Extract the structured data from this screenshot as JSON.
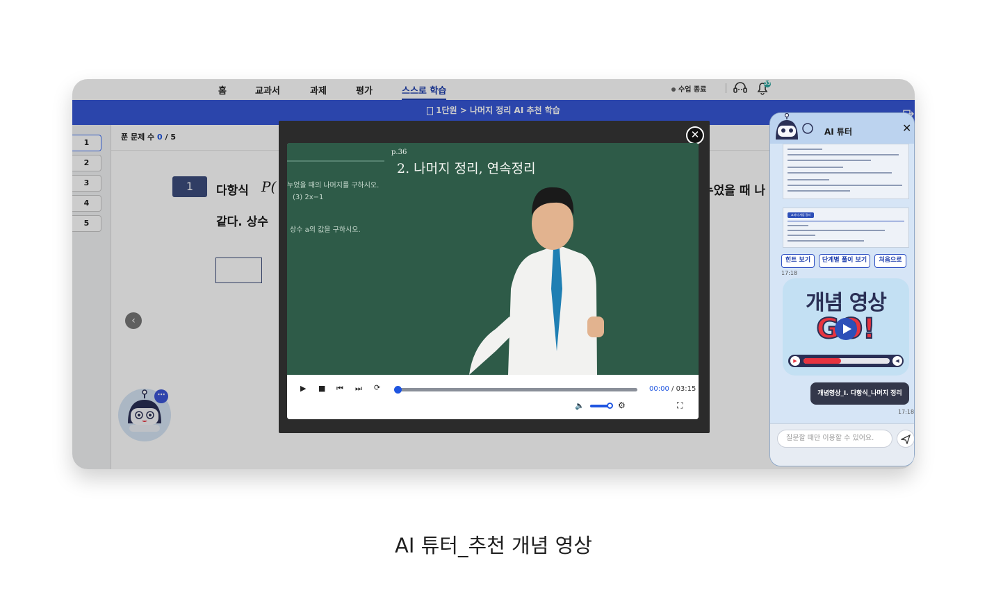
{
  "nav": {
    "items": [
      "홈",
      "교과서",
      "과제",
      "평가",
      "스스로 학습"
    ],
    "active_index": 4,
    "end_class_label": "수업 종료",
    "notification_count": "33"
  },
  "breadcrumb": "1단원 > 나머지 정리 AI 추천 학습",
  "question_nav": [
    "1",
    "2",
    "3",
    "4",
    "5"
  ],
  "solved": {
    "label": "푼 문제 수",
    "count": "0",
    "total": "/ 5"
  },
  "question": {
    "number": "1",
    "line1_start": "다항식",
    "line1_var": "P(",
    "line1_end": "누었을 때 나",
    "line2_start": "같다. 상수"
  },
  "video": {
    "board_heading": "2. 나머지 정리, 연속정리",
    "board_page": "p.36",
    "board_line1": "누었을 때의 나머지를 구하시오.",
    "board_line2": "(3) 2x−1",
    "board_line3": "상수 a의 값을 구하시오.",
    "time_current": "00:00",
    "time_total": "/ 03:15",
    "progress": 0.0,
    "volume": 0.85
  },
  "tutor": {
    "title": "AI 튜터",
    "chips": [
      "힌트 보기",
      "단계별 풀이 보기",
      "처음으로"
    ],
    "time1": "17:18",
    "promo_title": "개념 영상",
    "promo_go": "GO!",
    "user_message": "개념영상_I. 다항식_나머지 정리",
    "time2": "17:18",
    "input_placeholder": "질문할 때만 이용할 수 있어요.",
    "doc_tag": "교과서 개념 정리"
  },
  "caption": "AI 튜터_추천 개념 영상",
  "colors": {
    "accent": "#3657d6",
    "active_nav": "#1f3fae",
    "video_bg": "#2c5a47",
    "promo_red": "#e8343f"
  }
}
